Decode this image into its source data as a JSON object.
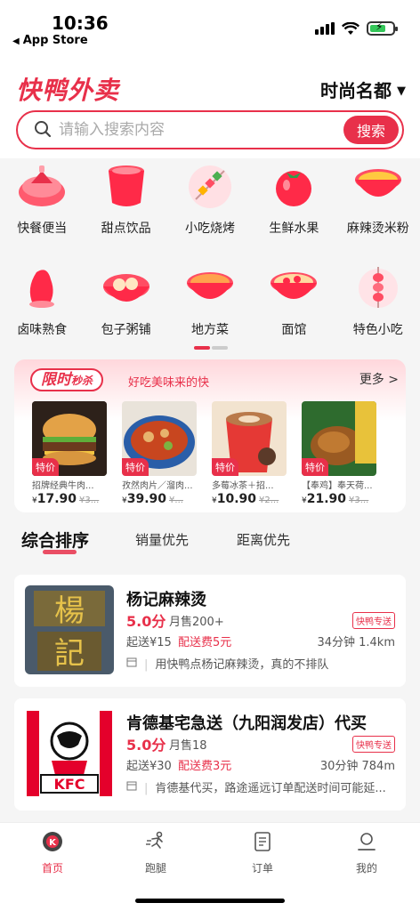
{
  "status_bar": {
    "time": "10:36",
    "back_app": "App Store"
  },
  "header": {
    "logo": "快鸭外卖",
    "city": "时尚名都"
  },
  "search": {
    "placeholder": "请输入搜索内容",
    "button_label": "搜索"
  },
  "categories": [
    {
      "label": "快餐便当",
      "icon": "fast-food-bowl-icon"
    },
    {
      "label": "甜点饮品",
      "icon": "drink-cup-icon"
    },
    {
      "label": "小吃烧烤",
      "icon": "skewer-icon"
    },
    {
      "label": "生鲜水果",
      "icon": "tomato-icon"
    },
    {
      "label": "麻辣烫米粉",
      "icon": "noodle-bowl-icon"
    },
    {
      "label": "卤味熟食",
      "icon": "braised-meat-icon"
    },
    {
      "label": "包子粥铺",
      "icon": "bun-icon"
    },
    {
      "label": "地方菜",
      "icon": "local-dish-icon"
    },
    {
      "label": "面馆",
      "icon": "noodle-icon"
    },
    {
      "label": "特色小吃",
      "icon": "snack-skewer-icon"
    }
  ],
  "flash_sale": {
    "badge_main": "限时",
    "badge_small": "秒杀",
    "subtitle": "好吃美味来的快",
    "more": "更多 >",
    "items": [
      {
        "tag": "特价",
        "name": "招牌经典牛肉...",
        "currency": "¥",
        "price": "17.90",
        "old_price": "¥3..."
      },
      {
        "tag": "特价",
        "name": "孜然肉片／溜肉...",
        "currency": "¥",
        "price": "39.90",
        "old_price": "¥..."
      },
      {
        "tag": "特价",
        "name": "多莓冰茶＋招...",
        "currency": "¥",
        "price": "10.90",
        "old_price": "¥2..."
      },
      {
        "tag": "特价",
        "name": "【奉鸡】奉天荷...",
        "currency": "¥",
        "price": "21.90",
        "old_price": "¥3..."
      }
    ]
  },
  "sort": {
    "tabs": [
      "综合排序",
      "销量优先",
      "距离优先"
    ],
    "active": "综合排序"
  },
  "stores": [
    {
      "name": "杨记麻辣烫",
      "score": "5.0分",
      "sales": "月售200+",
      "badge": "快鸭专送",
      "min_order": "起送¥15",
      "delivery_fee": "配送费5元",
      "time_distance": "34分钟 1.4km",
      "desc": "用快鸭点杨记麻辣烫，真的不排队"
    },
    {
      "name": "肯德基宅急送（九阳润发店）代买",
      "score": "5.0分",
      "sales": "月售18",
      "badge": "快鸭专送",
      "min_order": "起送¥30",
      "delivery_fee": "配送费3元",
      "time_distance": "30分钟 784m",
      "desc": "肯德基代买，路途遥远订单配送时间可能延..."
    }
  ],
  "bottom_nav": [
    {
      "label": "首页",
      "active": true
    },
    {
      "label": "跑腿",
      "active": false
    },
    {
      "label": "订单",
      "active": false
    },
    {
      "label": "我的",
      "active": false
    }
  ],
  "colors": {
    "accent": "#e8304a"
  }
}
